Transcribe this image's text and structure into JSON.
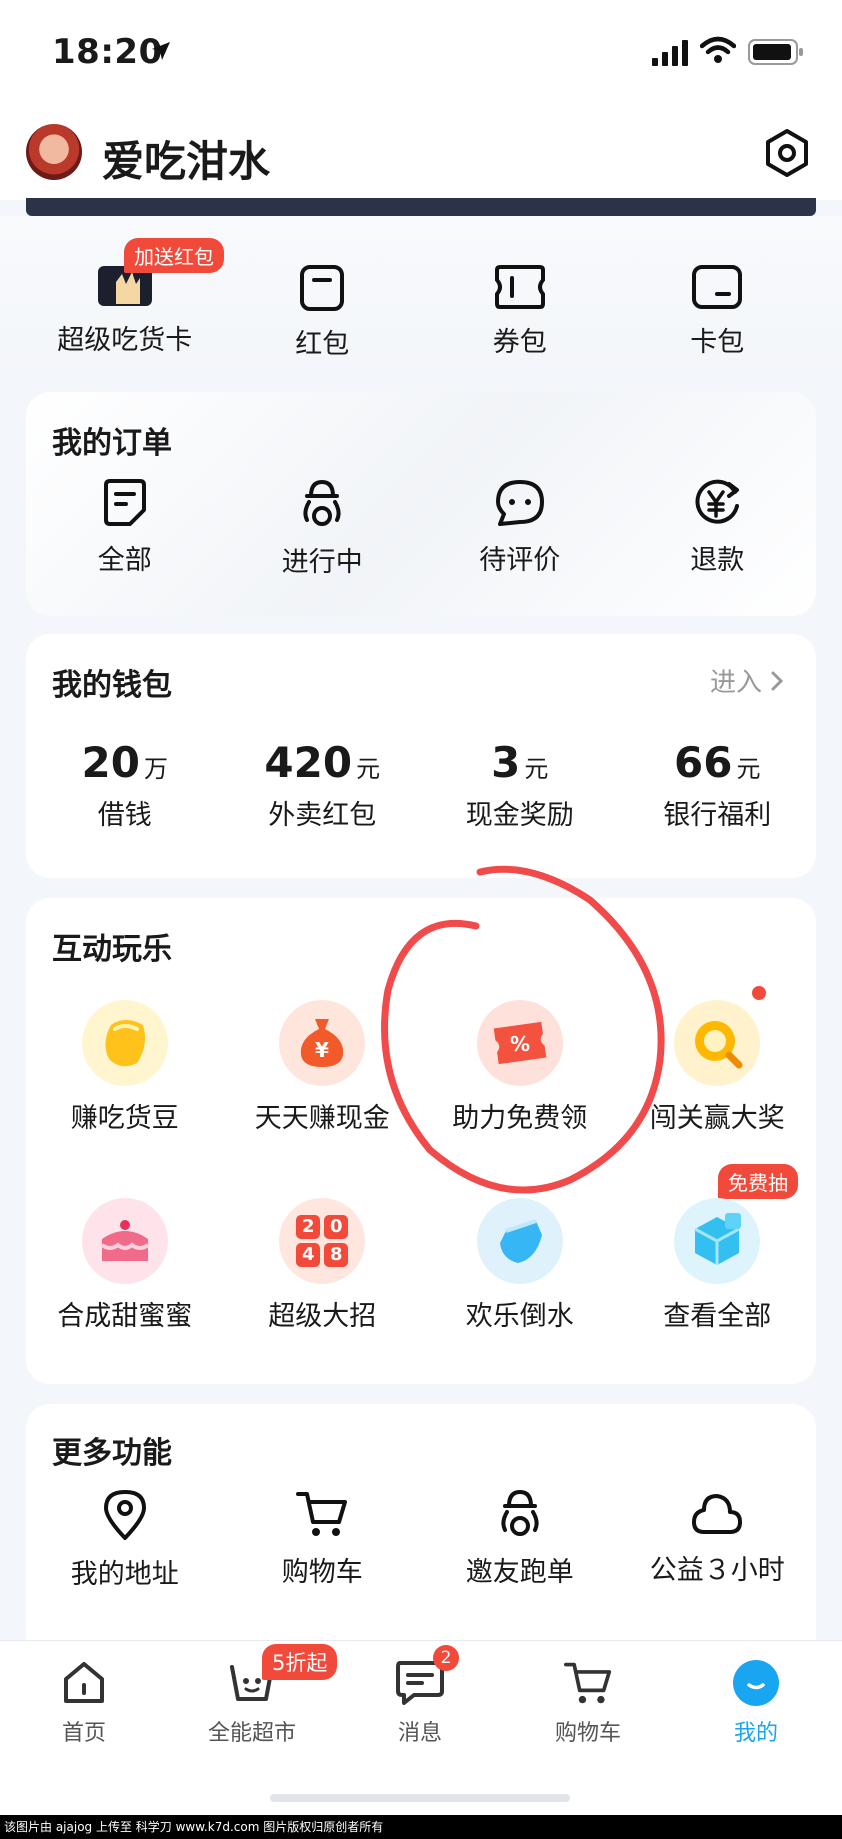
{
  "status": {
    "time": "18:20"
  },
  "header": {
    "username": "爱吃泔水"
  },
  "quick": {
    "items": [
      {
        "label": "超级吃货卡",
        "icon": "snack-card-icon"
      },
      {
        "label": "红包",
        "icon": "red-envelope-icon"
      },
      {
        "label": "券包",
        "icon": "coupon-icon"
      },
      {
        "label": "卡包",
        "icon": "card-wallet-icon"
      }
    ],
    "badge": "加送红包"
  },
  "orders": {
    "title": "我的订单",
    "items": [
      {
        "label": "全部",
        "icon": "document-icon"
      },
      {
        "label": "进行中",
        "icon": "scooter-rider-icon"
      },
      {
        "label": "待评价",
        "icon": "chat-bubble-icon"
      },
      {
        "label": "退款",
        "icon": "refund-yen-icon"
      }
    ]
  },
  "wallet": {
    "title": "我的钱包",
    "enter": "进入",
    "items": [
      {
        "value": "20",
        "unit": "万",
        "label": "借钱"
      },
      {
        "value": "420",
        "unit": "元",
        "label": "外卖红包"
      },
      {
        "value": "3",
        "unit": "元",
        "label": "现金奖励"
      },
      {
        "value": "66",
        "unit": "元",
        "label": "银行福利"
      }
    ]
  },
  "games": {
    "title": "互动玩乐",
    "row1": [
      {
        "label": "赚吃货豆",
        "icon": "bean-icon",
        "color": "#ffcc2a"
      },
      {
        "label": "天天赚现金",
        "icon": "money-bag-icon",
        "color": "#f25a2a"
      },
      {
        "label": "助力免费领",
        "icon": "discount-coupon-icon",
        "color": "#f2523e"
      },
      {
        "label": "闯关赢大奖",
        "icon": "magnifier-coin-icon",
        "color": "#ffb800"
      }
    ],
    "row2": [
      {
        "label": "合成甜蜜蜜",
        "icon": "cake-icon",
        "color": "#f06a8a"
      },
      {
        "label": "超级大招",
        "icon": "game-2048-icon",
        "color": "#f24a3a"
      },
      {
        "label": "欢乐倒水",
        "icon": "water-cup-icon",
        "color": "#36b6f5"
      },
      {
        "label": "查看全部",
        "icon": "cube-icon",
        "color": "#33bff0"
      }
    ],
    "row2_badge": "免费抽",
    "tile_2048": [
      "2",
      "0",
      "4",
      "8"
    ]
  },
  "more": {
    "title": "更多功能",
    "items": [
      {
        "label": "我的地址",
        "icon": "location-pin-icon"
      },
      {
        "label": "购物车",
        "icon": "shopping-cart-icon"
      },
      {
        "label": "邀友跑单",
        "icon": "scooter-rider-icon"
      },
      {
        "label": "公益３小时",
        "icon": "cloud-heart-icon"
      }
    ]
  },
  "tabs": {
    "items": [
      {
        "label": "首页",
        "icon": "home-icon"
      },
      {
        "label": "全能超市",
        "icon": "market-basket-icon"
      },
      {
        "label": "消息",
        "icon": "message-icon"
      },
      {
        "label": "购物车",
        "icon": "shopping-cart-icon"
      },
      {
        "label": "我的",
        "icon": "profile-icon"
      }
    ],
    "market_badge": "5折起",
    "message_count": "2",
    "active_color": "#19a6f0"
  },
  "footer": {
    "text": "该图片由 ajajog 上传至 科学刀 www.k7d.com 图片版权归原创者所有"
  }
}
